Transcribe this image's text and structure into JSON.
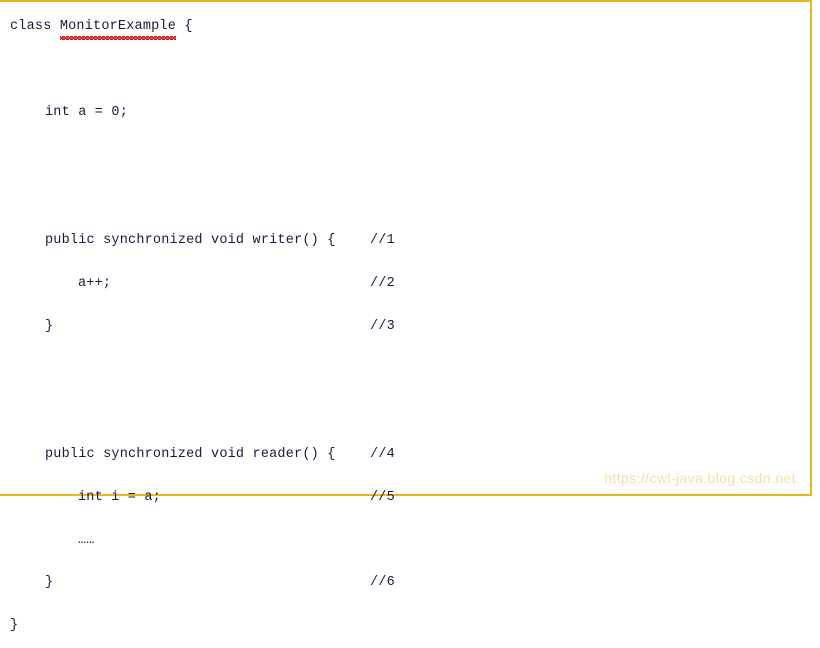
{
  "figure": {
    "kind": "java-code-listing",
    "border_color": "#e8b923",
    "background_color": "#ffffff",
    "text_color": "#1a1a3a"
  },
  "code": {
    "language": "Java",
    "class_name": "MonitorExample",
    "lines": [
      {
        "indent": 0,
        "text": "class ",
        "identifier": "MonitorExample",
        "identifier_misspelled": true,
        "text_after": " {",
        "comment": ""
      },
      {
        "indent": 0,
        "text": "",
        "comment": ""
      },
      {
        "indent": 1,
        "text": "int a = 0;",
        "comment": ""
      },
      {
        "indent": 0,
        "text": "",
        "comment": ""
      },
      {
        "indent": 0,
        "text": "",
        "comment": ""
      },
      {
        "indent": 1,
        "text": "public synchronized void writer() {",
        "comment": "//1"
      },
      {
        "indent": 2,
        "text": "a++;",
        "comment": "//2"
      },
      {
        "indent": 1,
        "text": "}",
        "comment": "//3"
      },
      {
        "indent": 0,
        "text": "",
        "comment": ""
      },
      {
        "indent": 0,
        "text": "",
        "comment": ""
      },
      {
        "indent": 1,
        "text": "public synchronized void reader() {",
        "comment": "//4"
      },
      {
        "indent": 2,
        "text": "int i = a;",
        "comment": "//5"
      },
      {
        "indent": 2,
        "text": "……",
        "comment": ""
      },
      {
        "indent": 1,
        "text": "}",
        "comment": "//6"
      },
      {
        "indent": 0,
        "text": "}",
        "comment": ""
      }
    ]
  },
  "watermark": {
    "text": "https://cwl-java.blog.csdn.net",
    "color": "#f2dfa8"
  }
}
